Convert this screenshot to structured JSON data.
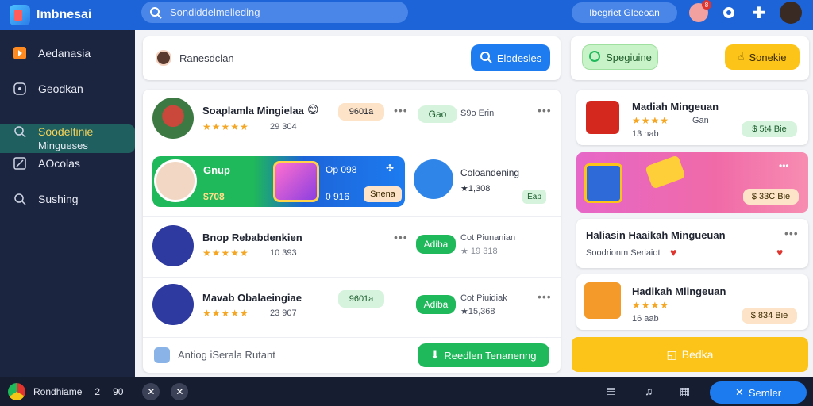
{
  "app": {
    "title": "Imbnesai"
  },
  "search": {
    "placeholder": "Sondiddelmelieding"
  },
  "topbar": {
    "pill_label": "Ibegriet Gleeoan",
    "notif_badge": "8"
  },
  "sidebar": {
    "items": [
      {
        "label": "Aedanasia",
        "icon": "play-icon"
      },
      {
        "label": "Geodkan",
        "icon": "message-icon"
      },
      {
        "label": "Soodeltinie",
        "sub": "Mingueses",
        "icon": "search-icon"
      },
      {
        "label": "AOcolas",
        "icon": "edit-icon"
      },
      {
        "label": "Sushing",
        "icon": "search-icon"
      }
    ]
  },
  "header_card": {
    "label": "Ranesdclan",
    "button": "Elodesles"
  },
  "right_header": {
    "green_button": "Spegiuine",
    "yellow_button": "Sonekie"
  },
  "feed": {
    "row1": {
      "title": "Soaplamla Mingielaa",
      "rating": "29 304",
      "badge": "9601a",
      "action": "Gao",
      "side": "S9o Erin"
    },
    "banner": {
      "title": "Gnup",
      "amount": "$708",
      "code": "Op 098",
      "count": "0 916",
      "button": "Snena"
    },
    "row2_side": {
      "title": "Coloandening",
      "price": "★1,308",
      "button": "Eap"
    },
    "row3": {
      "title": "Bnop Rebabdenkien",
      "rating": "10 393",
      "action": "Adiba",
      "side_title": "Cot Piunanian",
      "side_sub": "★ 19 318"
    },
    "row4": {
      "title": "Mavab Obalaeingiae",
      "rating": "23 907",
      "badge": "9601a",
      "action": "Adiba",
      "side_title": "Cot Piuidiak",
      "side_sub": "★15,368"
    },
    "footer": {
      "label": "Antiog iSerala Rutant",
      "button": "Reedlen Tenanenng"
    }
  },
  "right": {
    "item1": {
      "title": "Madiah Mingeuan",
      "sub": "Gan",
      "price": "13 nab",
      "badge": "$ 5t4 Bie"
    },
    "promo": {
      "badge": "$ 33C Bie"
    },
    "item2": {
      "title": "Haliasin Haaikah Mingueuan",
      "sub": "Soodrionm Seriaiot"
    },
    "item3": {
      "title": "Hadikah Mlingeuan",
      "price": "16 aab",
      "badge": "$ 834 Bie"
    },
    "bottom_button": "Bedka"
  },
  "bottombar": {
    "label": "Rondhiame",
    "num1": "2",
    "num2": "90",
    "button": "Semler"
  },
  "colors": {
    "primary": "#1d64d8",
    "green": "#1fb85a",
    "yellow": "#fcc419",
    "sidebar": "#1c2540"
  }
}
